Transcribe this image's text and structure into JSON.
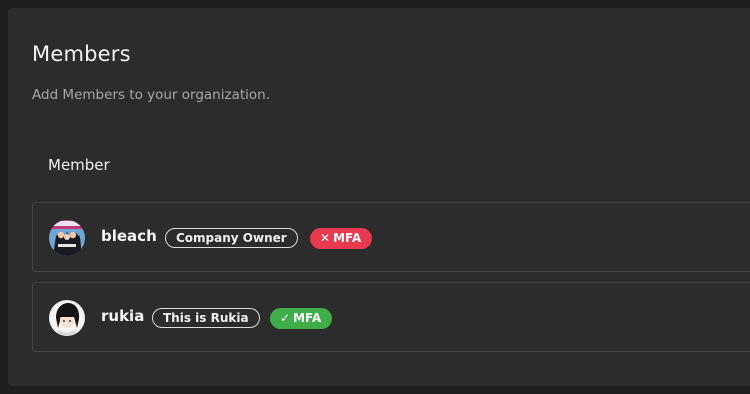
{
  "page": {
    "title": "Members",
    "subtitle": "Add Members to your organization.",
    "column_header": "Member"
  },
  "members": [
    {
      "name": "bleach",
      "role": "Company Owner",
      "mfa_label": "MFA",
      "mfa_enabled": false,
      "mfa_icon": "close-icon",
      "mfa_color": "#e83a4f"
    },
    {
      "name": "rukia",
      "role": "This is Rukia",
      "mfa_label": "MFA",
      "mfa_enabled": true,
      "mfa_icon": "check-icon",
      "mfa_color": "#3fae4a"
    }
  ]
}
